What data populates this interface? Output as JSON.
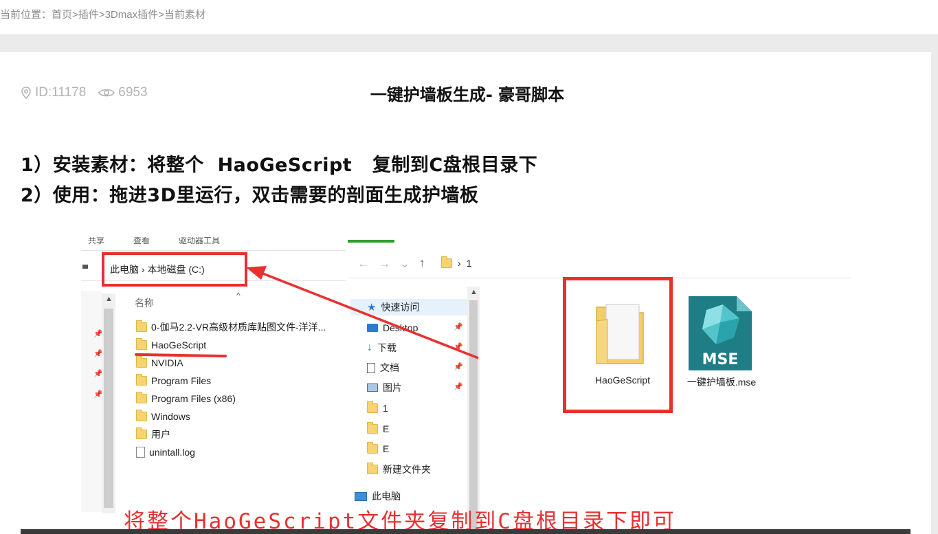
{
  "breadcrumb": {
    "prefix": "当前位置：",
    "items": [
      "首页",
      "插件",
      "3Dmax插件",
      "当前素材"
    ],
    "sep": ">"
  },
  "meta": {
    "id_label": "ID:11178",
    "views": "6953",
    "id_icon": "location-pin-icon",
    "views_icon": "eye-icon"
  },
  "title": "一键护墙板生成- 豪哥脚本",
  "instructions": {
    "line1": "1）安装素材：将整个  HaoGeScript   复制到C盘根目录下",
    "line2": "2）使用：拖进3D里运行，双击需要的剖面生成护墙板"
  },
  "figure": {
    "left_window": {
      "ribbon": [
        "共享",
        "查看",
        "驱动器工具"
      ],
      "address": "此电脑  ›  本地磁盘 (C:)",
      "column_header": "名称",
      "files": [
        {
          "name": "0-伽马2.2-VR高级材质库贴图文件-洋洋...",
          "type": "folder"
        },
        {
          "name": "HaoGeScript",
          "type": "folder"
        },
        {
          "name": "NVIDIA",
          "type": "folder"
        },
        {
          "name": "Program Files",
          "type": "folder"
        },
        {
          "name": "Program Files (x86)",
          "type": "folder"
        },
        {
          "name": "Windows",
          "type": "folder"
        },
        {
          "name": "用户",
          "type": "folder"
        },
        {
          "name": "unintall.log",
          "type": "file"
        }
      ]
    },
    "right_window": {
      "crumb": "1",
      "nav_items": [
        {
          "label": "快速访问",
          "icon": "star-icon"
        },
        {
          "label": "Desktop",
          "icon": "desktop-icon"
        },
        {
          "label": "下载",
          "icon": "download-icon"
        },
        {
          "label": "文档",
          "icon": "document-icon"
        },
        {
          "label": "图片",
          "icon": "picture-icon"
        },
        {
          "label": "1",
          "icon": "folder-icon"
        },
        {
          "label": "E",
          "icon": "folder-icon"
        },
        {
          "label": "E",
          "icon": "folder-icon"
        },
        {
          "label": "新建文件夹",
          "icon": "folder-icon"
        },
        {
          "label": "此电脑",
          "icon": "computer-icon"
        }
      ],
      "big_items": [
        {
          "label": "HaoGeScript",
          "icon": "folder-icon"
        },
        {
          "label": "一键护墙板.mse",
          "icon": "mse-file-icon",
          "badge": "MSE"
        }
      ]
    },
    "caption": "将整个HaoGeScript文件夹复制到C盘根目录下即可",
    "annotation_color": "#e8302f"
  }
}
